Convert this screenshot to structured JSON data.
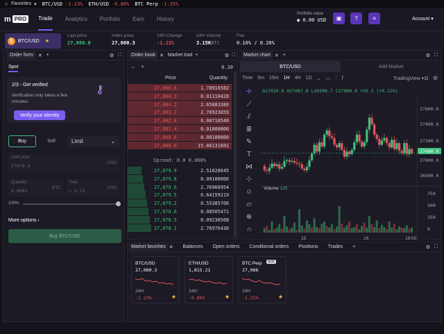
{
  "ticker": {
    "favorites": "Favorites",
    "items": [
      {
        "pair": "BTC/USD",
        "change": "-1.23%"
      },
      {
        "pair": "ETH/USD",
        "change": "-0.80%"
      },
      {
        "pair": "BTC Perp",
        "change": "-1.25%"
      }
    ]
  },
  "nav": {
    "logo": "PRO",
    "tabs": [
      "Trade",
      "Analytics",
      "Portfolio",
      "Earn",
      "History"
    ],
    "portfolio_label": "Portfolio value",
    "portfolio_value": "0.00 USD",
    "account": "Account"
  },
  "market": {
    "pair": "BTC/USD",
    "last_price_label": "Last price",
    "last_price": "27,080.0",
    "index_price_label": "Index price",
    "index_price": "27,080.3",
    "change_label": "24H Change",
    "change": "-1.23%",
    "volume_label": "24H Volume",
    "volume": "3.15K",
    "volume_unit": "BTC",
    "fee_label": "Fee",
    "fee_maker": "0.16",
    "fee_taker": "0.26"
  },
  "order_form": {
    "title": "Order form",
    "tab": "Spot",
    "verify_step": "2/3 - Get verified",
    "verify_text": "Verification only takes a few minutes.",
    "verify_button": "Verify your identity",
    "buy": "Buy",
    "sell": "Sell",
    "type": "Limit",
    "limit_label": "Limit price",
    "limit_value": "27079.9",
    "limit_unit": "USD",
    "qty_label": "Quantity",
    "qty_value": "0.0001",
    "qty_unit": "BTC",
    "total_label": "Total",
    "total_value": "~ 2.71",
    "total_unit": "USD",
    "pct": "100%",
    "more": "More options",
    "submit": "Buy BTC/USD"
  },
  "order_book": {
    "title": "Order book",
    "tab2": "Market trad",
    "step": "0.10",
    "price_header": "Price",
    "qty_header": "Quantity",
    "asks": [
      [
        "27,086.0",
        "1.78916582"
      ],
      [
        "27,084.3",
        "0.01110428"
      ],
      [
        "27,084.2",
        "2.65883380"
      ],
      [
        "27,083.2",
        "2.76923859"
      ],
      [
        "27,082.8",
        "0.00710540"
      ],
      [
        "27,081.4",
        "0.01000000"
      ],
      [
        "27,080.6",
        "0.00100000"
      ],
      [
        "27,080.0",
        "15.86131601"
      ]
    ],
    "spread": "Spread: 0.0 0.000%",
    "bids": [
      [
        "27,079.9",
        "2.51628645"
      ],
      [
        "27,079.8",
        "0.00100000"
      ],
      [
        "27,079.6",
        "2.76960954"
      ],
      [
        "27,079.5",
        "0.64159219"
      ],
      [
        "27,079.2",
        "0.55385706"
      ],
      [
        "27,078.6",
        "0.08505471"
      ],
      [
        "27,078.5",
        "0.09230508"
      ],
      [
        "27,078.1",
        "2.76976430"
      ]
    ]
  },
  "chart": {
    "title": "Market chart",
    "tab_pair": "BTC/USD",
    "tab_add": "Add Market",
    "intervals": [
      "Time",
      "5m",
      "15m",
      "1H",
      "4H",
      "1D"
    ],
    "tradingview": "TradingView",
    "ohlc": {
      "o": "O27020.8",
      "h": "H27087.8",
      "l": "L26998.7",
      "c": "C27080.0",
      "chg": "+59.2 (+0.22%)"
    },
    "volume_label": "Volume",
    "volume_value": "125",
    "price_axis": [
      "27600.0",
      "27400.0",
      "27200.0",
      "27080.0",
      "27000.0",
      "26800.0"
    ],
    "vol_axis": [
      "750",
      "500",
      "250",
      "0"
    ],
    "time_axis": [
      "15",
      "16",
      "18:00"
    ]
  },
  "bottom": {
    "tabs": [
      "Market favorites",
      "Balances",
      "Open orders",
      "Conditional orders",
      "Positions",
      "Trades"
    ],
    "cards": [
      {
        "pair": "BTC/USD",
        "price": "27,080.3",
        "label": "24H",
        "change": "-1.23%",
        "badge": ""
      },
      {
        "pair": "ETH/USD",
        "price": "1,815.21",
        "label": "24H",
        "change": "-0.80%",
        "badge": ""
      },
      {
        "pair": "BTC Perp",
        "price": "27,086",
        "label": "24H",
        "change": "-1.25%",
        "badge": "50x"
      }
    ]
  },
  "colors": {
    "accent": "#7b5cf0",
    "red": "#e3565c",
    "green": "#3fbf7f",
    "bg": "#15131b"
  }
}
